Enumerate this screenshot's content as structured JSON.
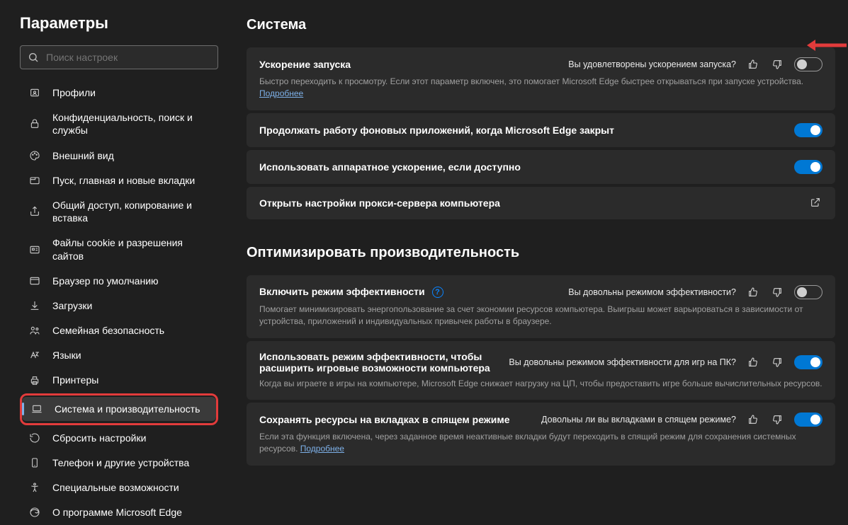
{
  "sidebar": {
    "title": "Параметры",
    "search_placeholder": "Поиск настроек",
    "items": [
      {
        "label": "Профили"
      },
      {
        "label": "Конфиденциальность, поиск и службы"
      },
      {
        "label": "Внешний вид"
      },
      {
        "label": "Пуск, главная и новые вкладки"
      },
      {
        "label": "Общий доступ, копирование и вставка"
      },
      {
        "label": "Файлы cookie и разрешения сайтов"
      },
      {
        "label": "Браузер по умолчанию"
      },
      {
        "label": "Загрузки"
      },
      {
        "label": "Семейная безопасность"
      },
      {
        "label": "Языки"
      },
      {
        "label": "Принтеры"
      },
      {
        "label": "Система и производительность"
      },
      {
        "label": "Сбросить настройки"
      },
      {
        "label": "Телефон и другие устройства"
      },
      {
        "label": "Специальные возможности"
      },
      {
        "label": "О программе Microsoft Edge"
      }
    ]
  },
  "sections": {
    "system_title": "Система",
    "optimize_title": "Оптимизировать производительность"
  },
  "cards": {
    "startup_boost": {
      "title": "Ускорение запуска",
      "desc": "Быстро переходить к просмотру. Если этот параметр включен, это помогает Microsoft Edge быстрее открываться при запуске устройства.",
      "more": "Подробнее",
      "question": "Вы удовлетворены ускорением запуска?",
      "toggle": false
    },
    "background_apps": {
      "title": "Продолжать работу фоновых приложений, когда Microsoft Edge закрыт",
      "toggle": true
    },
    "hw_accel": {
      "title": "Использовать аппаратное ускорение, если доступно",
      "toggle": true
    },
    "proxy": {
      "title": "Открыть настройки прокси-сервера компьютера"
    },
    "efficiency": {
      "title": "Включить режим эффективности",
      "desc": "Помогает минимизировать энергопользование за счет экономии ресурсов компьютера. Выигрыш может варьироваться в зависимости от устройства, приложений и индивидуальных привычек работы в браузере.",
      "question": "Вы довольны режимом эффективности?",
      "toggle": false
    },
    "gaming_efficiency": {
      "title": "Использовать режим эффективности, чтобы расширить игровые возможности компьютера",
      "desc": "Когда вы играете в игры на компьютере, Microsoft Edge снижает нагрузку на ЦП, чтобы предоставить игре больше вычислительных ресурсов.",
      "question": "Вы довольны режимом эффективности для игр на ПК?",
      "toggle": true
    },
    "sleeping_tabs": {
      "title": "Сохранять ресурсы на вкладках в спящем режиме",
      "desc": "Если эта функция включена, через заданное время неактивные вкладки будут переходить в спящий режим для сохранения системных ресурсов.",
      "more": "Подробнее",
      "question": "Довольны ли вы вкладками в спящем режиме?",
      "toggle": true
    }
  }
}
